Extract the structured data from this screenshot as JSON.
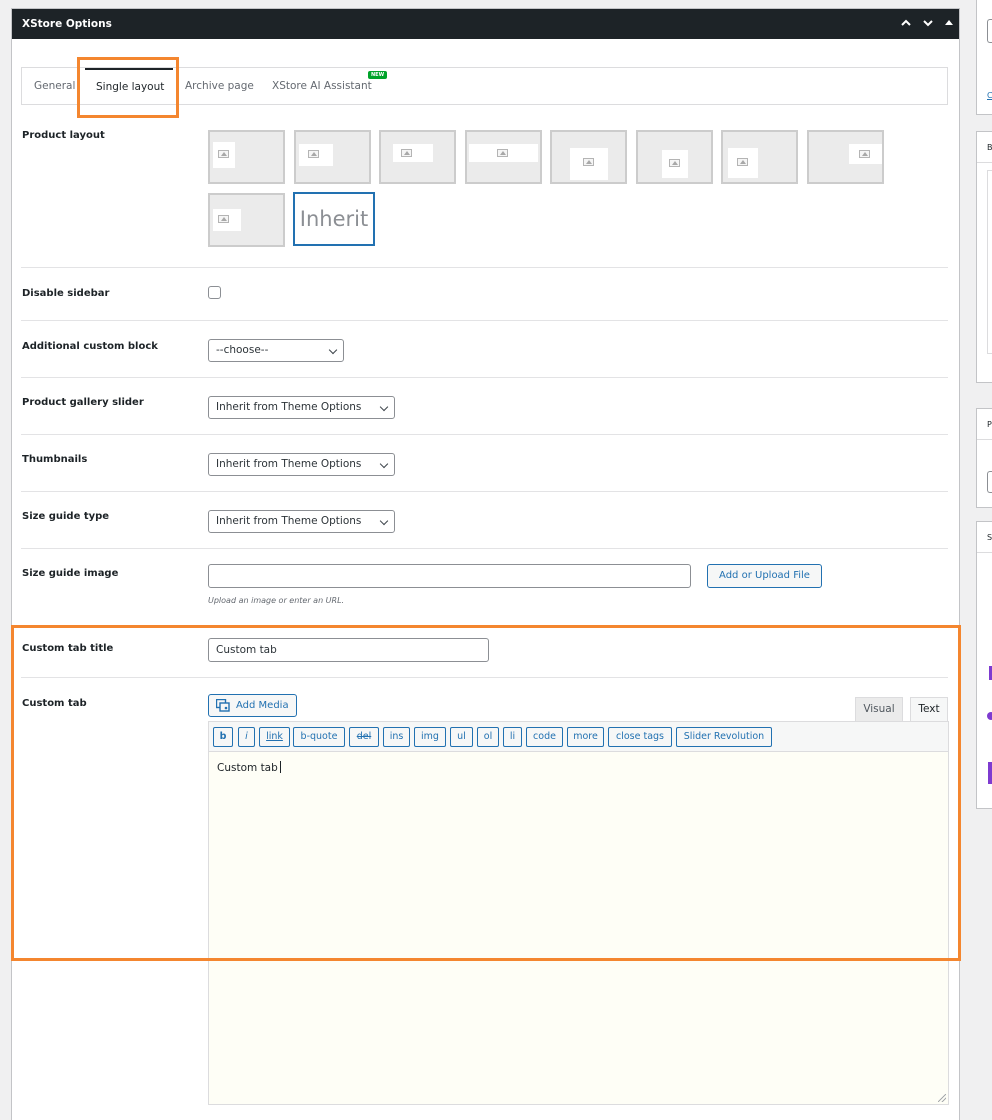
{
  "metabox": {
    "title": "XStore Options",
    "controls": {
      "up": "⌃",
      "down": "⌄",
      "toggle": "▲"
    }
  },
  "tabs": [
    {
      "label": "General",
      "active": false
    },
    {
      "label": "Single layout",
      "active": true
    },
    {
      "label": "Archive page",
      "active": false
    },
    {
      "label": "XStore AI Assistant",
      "active": false,
      "badge": "NEW"
    }
  ],
  "product_layout": {
    "label": "Product layout",
    "options_count": 9,
    "selected_label": "Inherit"
  },
  "disable_sidebar": {
    "label": "Disable sidebar",
    "checked": false
  },
  "additional_custom_block": {
    "label": "Additional custom block",
    "value": "--choose--"
  },
  "product_gallery_slider": {
    "label": "Product gallery slider",
    "value": "Inherit from Theme Options"
  },
  "thumbnails": {
    "label": "Thumbnails",
    "value": "Inherit from Theme Options"
  },
  "size_guide_type": {
    "label": "Size guide type",
    "value": "Inherit from Theme Options"
  },
  "size_guide_image": {
    "label": "Size guide image",
    "value": "",
    "button": "Add or Upload File",
    "hint": "Upload an image or enter an URL."
  },
  "custom_tab_title": {
    "label": "Custom tab title",
    "value": "Custom tab"
  },
  "custom_tab": {
    "label": "Custom tab",
    "add_media": "Add Media",
    "mode_visual": "Visual",
    "mode_text": "Text",
    "toolbar": [
      "b",
      "i",
      "link",
      "b-quote",
      "del",
      "ins",
      "img",
      "ul",
      "ol",
      "li",
      "code",
      "more",
      "close tags",
      "Slider Revolution"
    ],
    "content": "Custom tab"
  },
  "colors": {
    "accent": "#2271b1",
    "highlight": "#f4862f",
    "header": "#1d2327",
    "badge": "#00a32a"
  }
}
